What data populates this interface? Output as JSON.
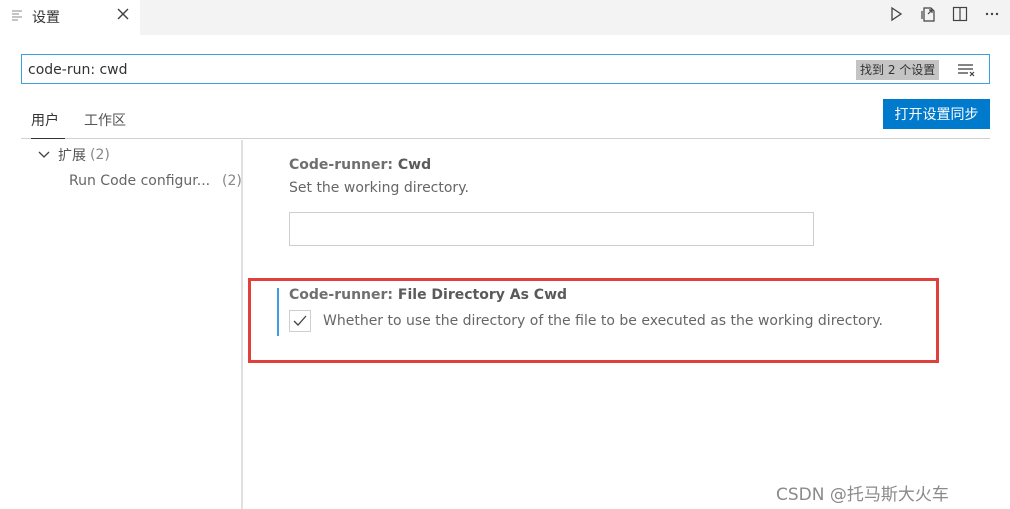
{
  "tab": {
    "title": "设置",
    "icon": "settings-file-icon"
  },
  "editor_actions": [
    "run-icon",
    "open-json-icon",
    "split-editor-icon",
    "more-actions-icon"
  ],
  "search": {
    "value": "code-run: cwd",
    "found_label": "找到 2 个设置"
  },
  "scopes": {
    "user": "用户",
    "workspace": "工作区"
  },
  "sync_button": "打开设置同步",
  "toc": {
    "extensions_label": "扩展",
    "extensions_count": "(2)",
    "run_code_label": "Run Code configur...",
    "run_code_count": "(2)"
  },
  "settings": {
    "cwd": {
      "category": "Code-runner: ",
      "name": "Cwd",
      "description": "Set the working directory.",
      "value": ""
    },
    "file_dir_as_cwd": {
      "category": "Code-runner: ",
      "name": "File Directory As Cwd",
      "description": "Whether to use the directory of the file to be executed as the working directory.",
      "checked": true
    }
  },
  "watermark": "CSDN @托马斯大火车",
  "colors": {
    "accent": "#007acc",
    "focus_border": "#3aa0e0",
    "highlight_border": "#e0413d"
  }
}
